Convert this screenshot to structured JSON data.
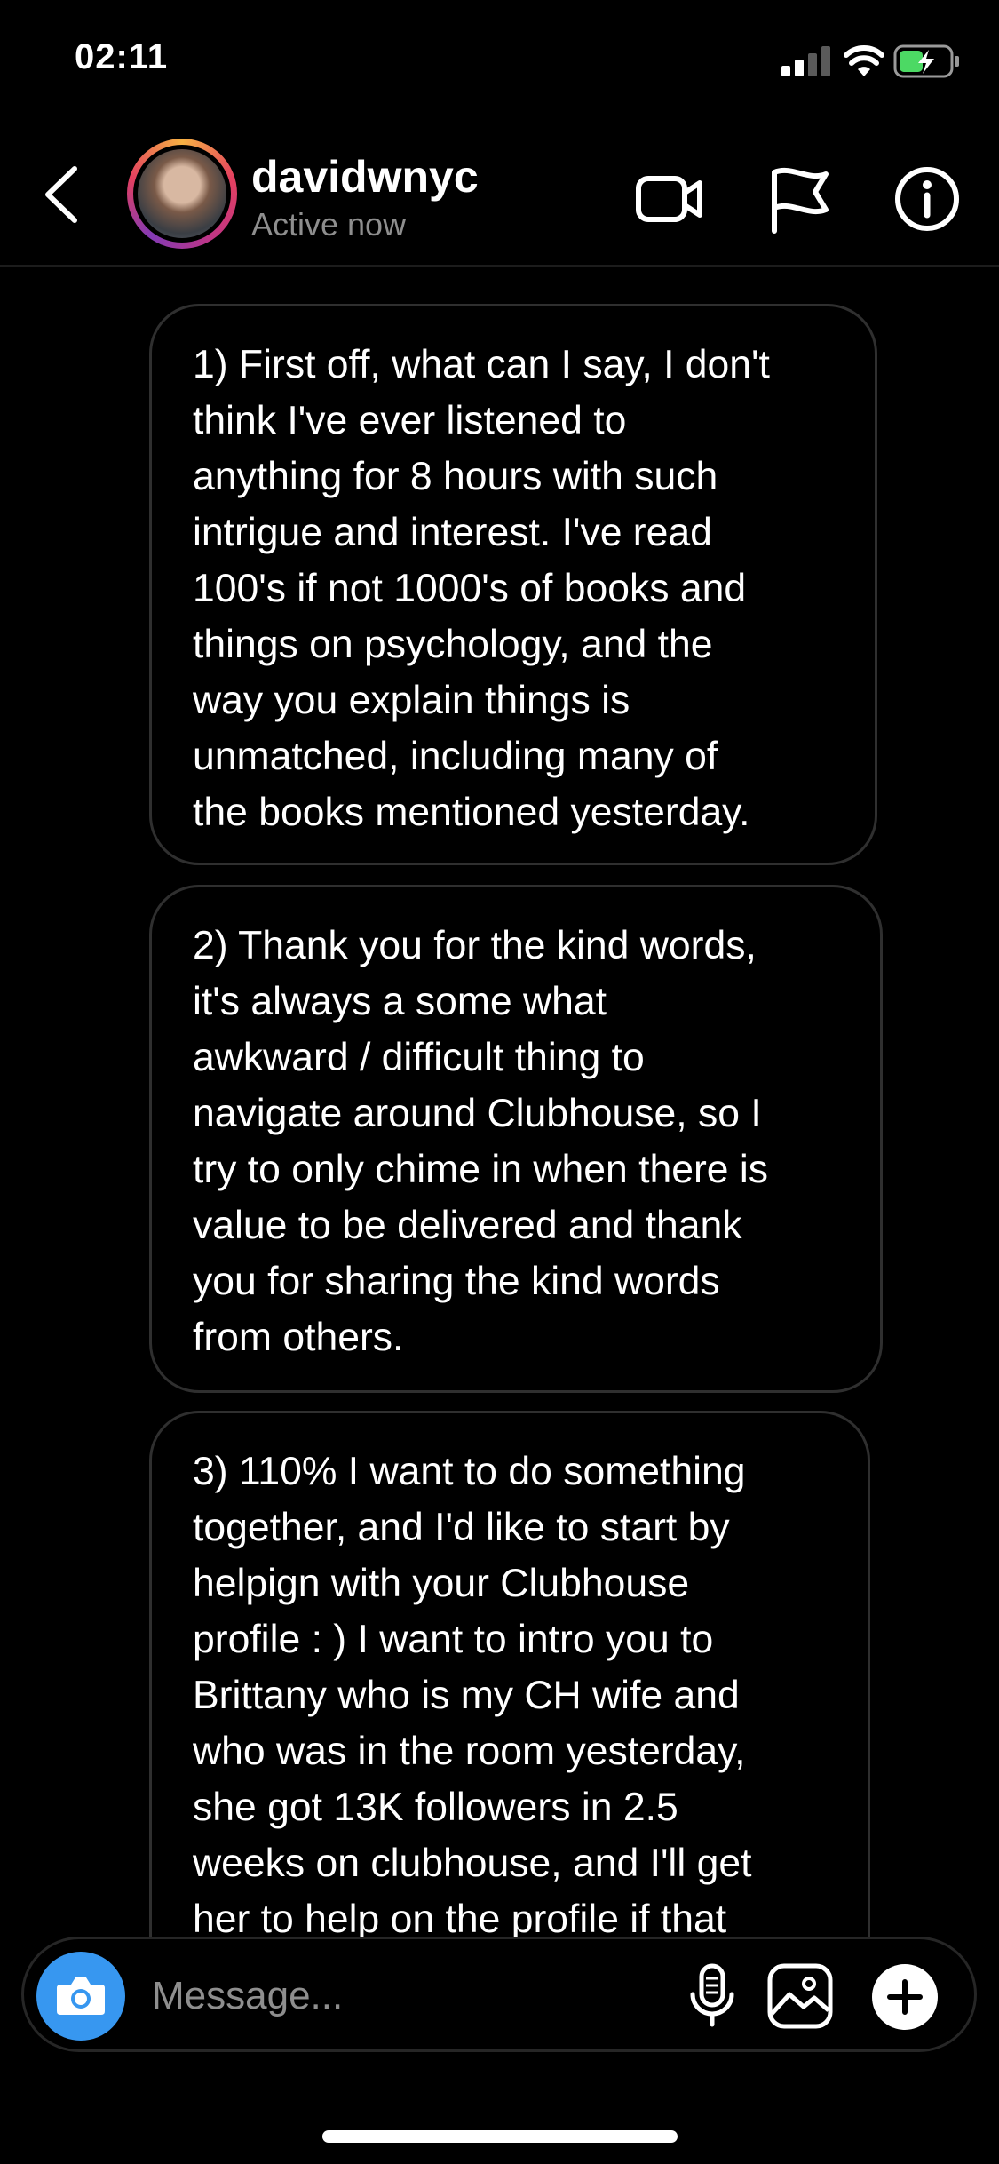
{
  "status_bar": {
    "time": "02:11"
  },
  "header": {
    "username": "davidwnyc",
    "presence": "Active now"
  },
  "messages": [
    {
      "text": "1) First off, what can I say, I don't\nthink I've ever listened to\nanything for 8 hours with such\nintrigue and interest.  I've read\n100's if not 1000's of books and\nthings on psychology, and the\nway you explain things is\nunmatched, including many of\nthe books mentioned yesterday."
    },
    {
      "text": "2) Thank you for the kind words,\nit's always a some what\nawkward / difficult thing to\nnavigate around Clubhouse, so I\ntry to only chime in when there is\nvalue to be delivered and thank\nyou for sharing the kind words\nfrom others."
    },
    {
      "text": "3) 110% I want to do something\ntogether, and I'd like to start by\nhelpign with your Clubhouse\nprofile : ) I want to intro you to\nBrittany who is my CH wife and\nwho was in the room yesterday,\nshe got 13K followers in 2.5\nweeks on clubhouse, and I'll get\nher to help on the profile if that"
    }
  ],
  "composer": {
    "placeholder": "Message..."
  },
  "colors": {
    "accent": "#3797f0",
    "battery": "#4cd964",
    "bubble_border": "#2f2f2f",
    "secondary_text": "#8e8e8e"
  },
  "icons": [
    "signal-icon",
    "wifi-icon",
    "battery-icon",
    "back-icon",
    "video-call-icon",
    "flag-icon",
    "info-icon",
    "camera-icon",
    "microphone-icon",
    "gallery-icon",
    "plus-icon"
  ]
}
